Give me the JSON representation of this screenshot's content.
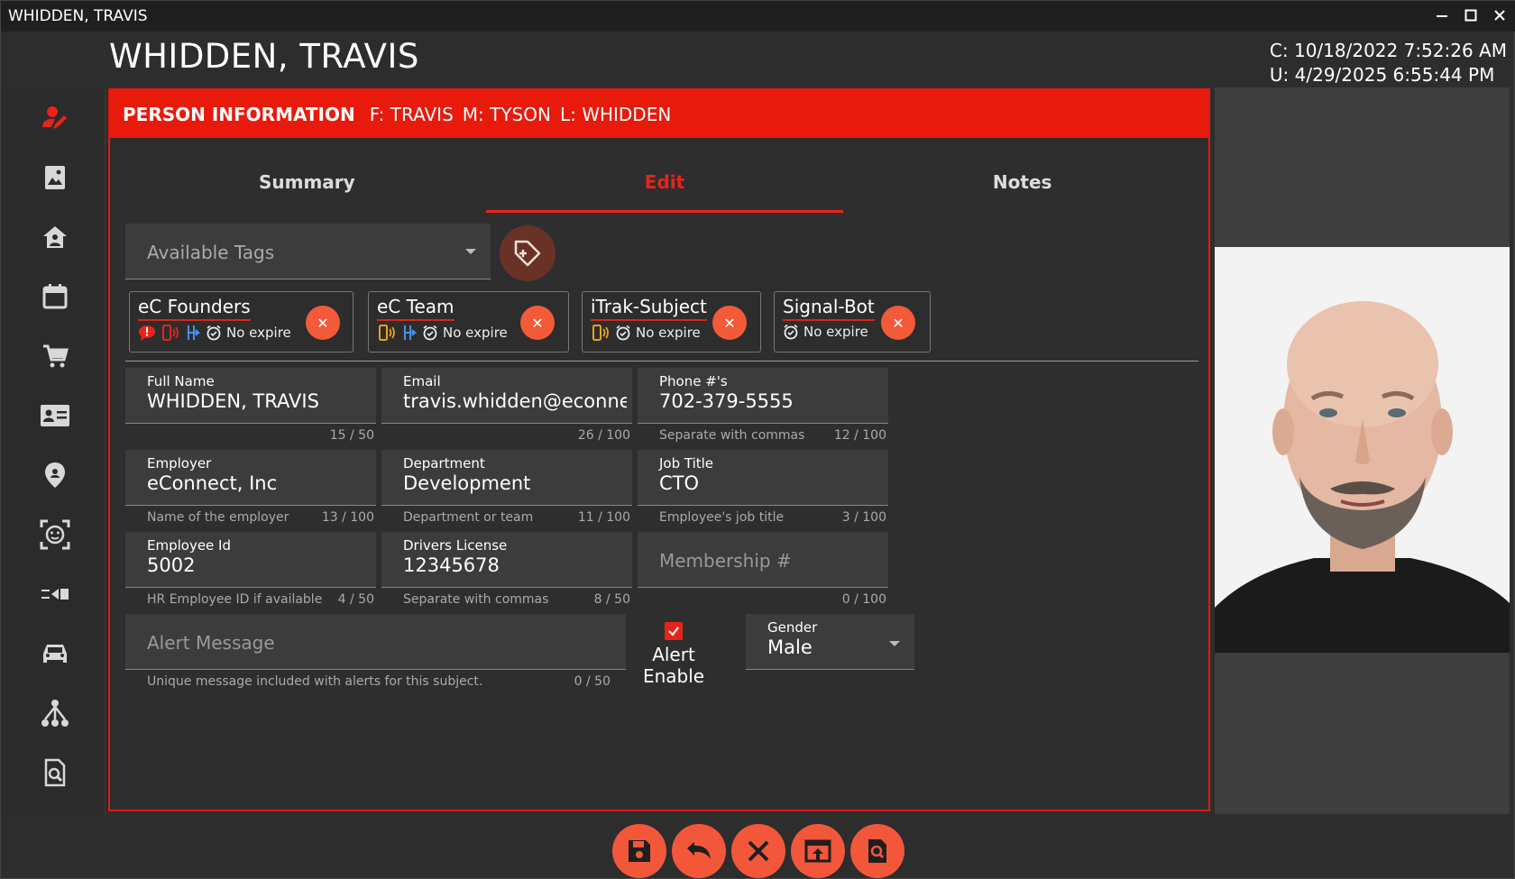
{
  "window": {
    "title": "WHIDDEN, TRAVIS"
  },
  "header": {
    "name": "WHIDDEN, TRAVIS",
    "created": "C: 10/18/2022 7:52:26 AM",
    "updated": "U: 4/29/2025 6:55:44 PM"
  },
  "sidebar": {
    "items": [
      {
        "icon": "person-edit-icon"
      },
      {
        "icon": "image-gallery-icon"
      },
      {
        "icon": "home-person-icon"
      },
      {
        "icon": "calendar-icon"
      },
      {
        "icon": "cart-icon"
      },
      {
        "icon": "id-card-icon"
      },
      {
        "icon": "map-pin-icon"
      },
      {
        "icon": "face-recognition-icon"
      },
      {
        "icon": "arrow-import-icon"
      },
      {
        "icon": "car-icon"
      },
      {
        "icon": "hierarchy-icon"
      },
      {
        "icon": "search-document-icon"
      }
    ]
  },
  "info_bar": {
    "label": "PERSON INFORMATION",
    "first": "F: TRAVIS",
    "middle": "M: TYSON",
    "last": "L: WHIDDEN"
  },
  "tabs": [
    {
      "label": "Summary"
    },
    {
      "label": "Edit",
      "active": true
    },
    {
      "label": "Notes"
    }
  ],
  "tag_select": {
    "placeholder": "Available Tags"
  },
  "tags": [
    {
      "name": "eC Founders",
      "expire": "No expire"
    },
    {
      "name": "eC Team",
      "expire": "No expire"
    },
    {
      "name": "iTrak-Subject",
      "expire": "No expire"
    },
    {
      "name": "Signal-Bot",
      "expire": "No expire"
    }
  ],
  "fields": {
    "full_name": {
      "label": "Full Name",
      "value": "WHIDDEN, TRAVIS",
      "hint": "",
      "count": "15 / 50"
    },
    "email": {
      "label": "Email",
      "value": "travis.whidden@econnect",
      "hint": "",
      "count": "26 / 100"
    },
    "phone": {
      "label": "Phone #'s",
      "value": "702-379-5555",
      "hint": "Separate with commas",
      "count": "12 / 100"
    },
    "employer": {
      "label": "Employer",
      "value": "eConnect, Inc",
      "hint": "Name of the employer",
      "count": "13 / 100"
    },
    "department": {
      "label": "Department",
      "value": "Development",
      "hint": "Department or team",
      "count": "11 / 100"
    },
    "job_title": {
      "label": "Job Title",
      "value": "CTO",
      "hint": "Employee's job title",
      "count": "3 / 100"
    },
    "employee_id": {
      "label": "Employee Id",
      "value": "5002",
      "hint": "HR Employee ID if available",
      "count": "4 / 50"
    },
    "drivers_license": {
      "label": "Drivers License",
      "value": "12345678",
      "hint": "Separate with commas",
      "count": "8 / 50"
    },
    "membership": {
      "placeholder": "Membership #",
      "count": "0 / 100"
    },
    "alert_message": {
      "placeholder": "Alert Message",
      "hint": "Unique message included with alerts for this subject.",
      "count": "0 / 50"
    },
    "alert_enable": {
      "label": "Alert Enable",
      "checked": true
    },
    "gender": {
      "label": "Gender",
      "value": "Male"
    }
  },
  "colors": {
    "accent": "#e8231a",
    "fab": "#f2573a"
  },
  "actions": [
    {
      "icon": "save-icon"
    },
    {
      "icon": "undo-icon"
    },
    {
      "icon": "close-icon"
    },
    {
      "icon": "export-icon"
    },
    {
      "icon": "search-icon"
    }
  ]
}
